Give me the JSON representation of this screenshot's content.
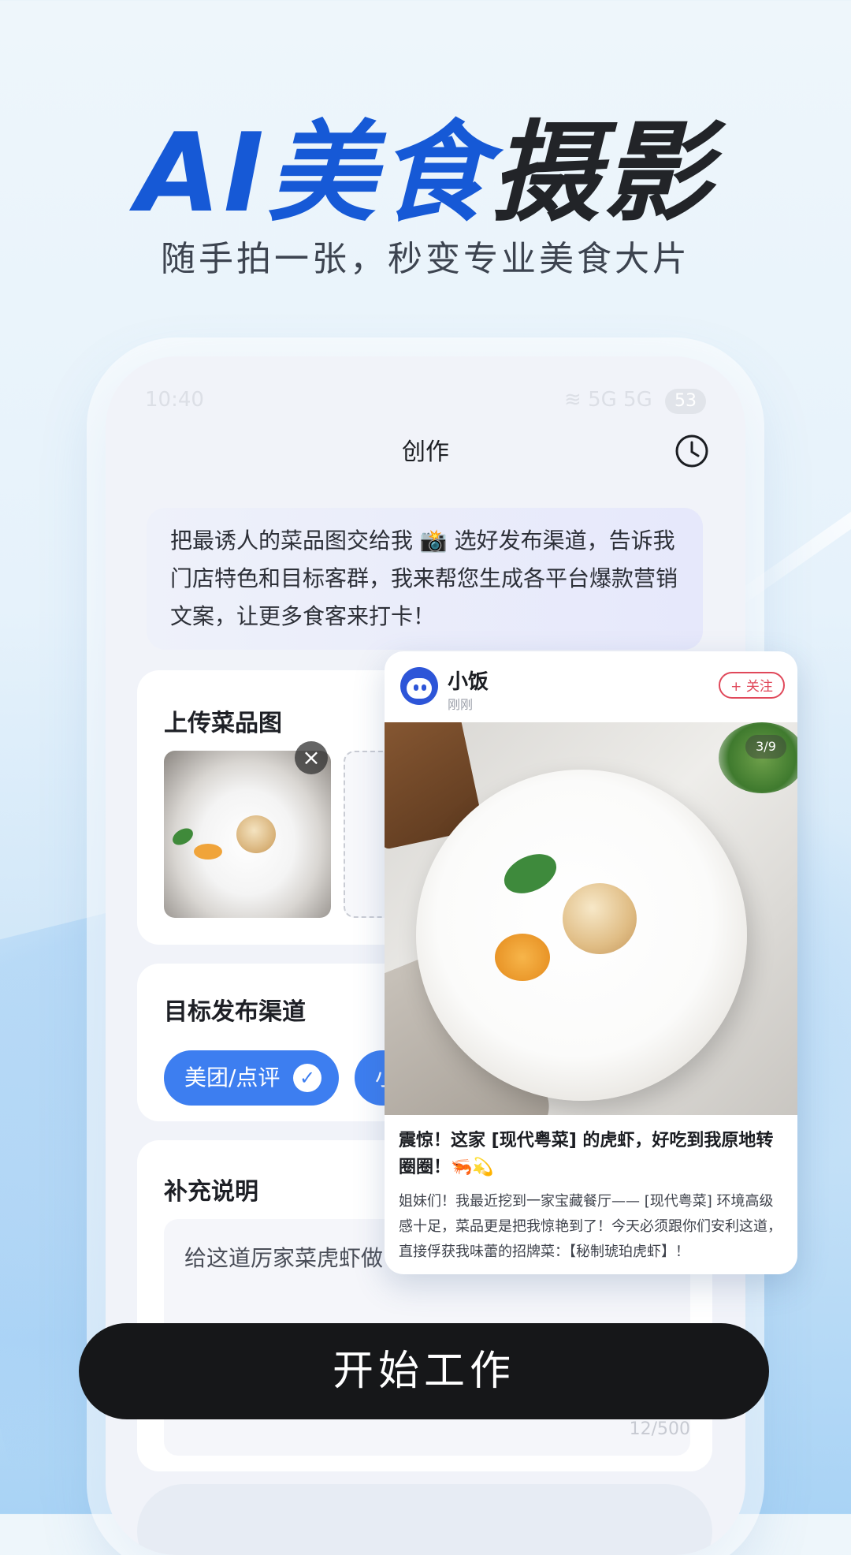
{
  "hero": {
    "title_blue": "AI美食",
    "title_dark": "摄影",
    "subtitle": "随手拍一张，秒变专业美食大片"
  },
  "status_bar": {
    "time": "10:40",
    "network": "5G 5G",
    "battery": "53"
  },
  "app": {
    "title": "创作",
    "history_icon": "clock-icon",
    "intro": "把最诱人的菜品图交给我 📸 选好发布渠道，告诉我门店特色和目标客群，我来帮您生成各平台爆款营销文案，让更多食客来打卡！"
  },
  "upload": {
    "title": "上传菜品图",
    "delete_icon": "×"
  },
  "channel": {
    "title": "目标发布渠道",
    "chips": [
      {
        "label": "美团/点评",
        "selected": true
      },
      {
        "label": "小",
        "selected": true
      }
    ],
    "check_icon": "✓"
  },
  "note": {
    "title": "补充说明",
    "value": "给这道厉家菜虎虾做",
    "counter": "12/500"
  },
  "post": {
    "username": "小饭",
    "time": "刚刚",
    "follow_label": "+ 关注",
    "page_indicator": "3/9",
    "title": "震惊！这家 [现代粤菜] 的虎虾，好吃到我原地转圈圈！🦐💫",
    "body": "姐妹们！我最近挖到一家宝藏餐厅—— [现代粤菜] 环境高级感十足，菜品更是把我惊艳到了！今天必须跟你们安利这道，直接俘获我味蕾的招牌菜：【秘制琥珀虎虾】！"
  },
  "cta": {
    "label": "开始工作"
  },
  "colors": {
    "brand_blue": "#1659d6",
    "chip_blue": "#3d7ef0",
    "follow_red": "#e0485a",
    "button_black": "#161719"
  }
}
